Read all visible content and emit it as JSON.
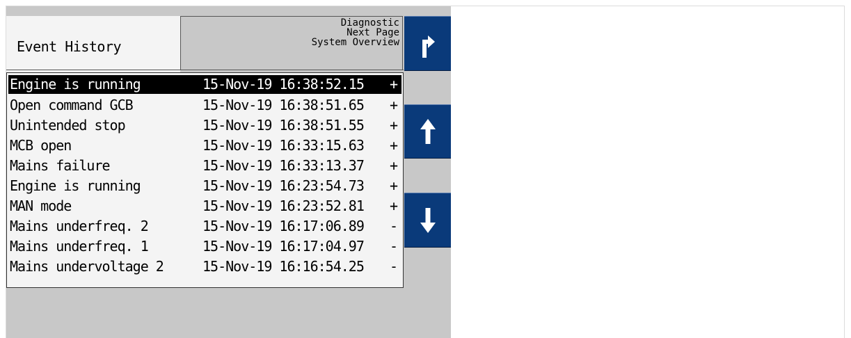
{
  "title": "Event History",
  "header_menu": [
    "Diagnostic",
    "Next Page",
    "System Overview"
  ],
  "events": [
    {
      "name": "Engine is running",
      "time": "15-Nov-19 16:38:52.15",
      "flag": "+",
      "selected": true
    },
    {
      "name": "Open command GCB",
      "time": "15-Nov-19 16:38:51.65",
      "flag": "+",
      "selected": false
    },
    {
      "name": "Unintended stop",
      "time": "15-Nov-19 16:38:51.55",
      "flag": "+",
      "selected": false
    },
    {
      "name": "MCB open",
      "time": "15-Nov-19 16:33:15.63",
      "flag": "+",
      "selected": false
    },
    {
      "name": "Mains failure",
      "time": "15-Nov-19 16:33:13.37",
      "flag": "+",
      "selected": false
    },
    {
      "name": "Engine is running",
      "time": "15-Nov-19 16:23:54.73",
      "flag": "+",
      "selected": false
    },
    {
      "name": "MAN mode",
      "time": "15-Nov-19 16:23:52.81",
      "flag": "+",
      "selected": false
    },
    {
      "name": "Mains underfreq. 2",
      "time": "15-Nov-19 16:17:06.89",
      "flag": "-",
      "selected": false
    },
    {
      "name": "Mains underfreq. 1",
      "time": "15-Nov-19 16:17:04.97",
      "flag": "-",
      "selected": false
    },
    {
      "name": "Mains undervoltage 2",
      "time": "15-Nov-19 16:16:54.25",
      "flag": "-",
      "selected": false
    }
  ],
  "buttons": {
    "top": {
      "icon": "turn-up-right-arrow-icon"
    },
    "up": {
      "icon": "arrow-up-icon"
    },
    "down": {
      "icon": "arrow-down-icon"
    }
  },
  "colors": {
    "button_blue": "#0a3a7a",
    "panel_gray": "#c8c8c8",
    "list_background": "#f4f4f4",
    "selection": "#000000"
  }
}
